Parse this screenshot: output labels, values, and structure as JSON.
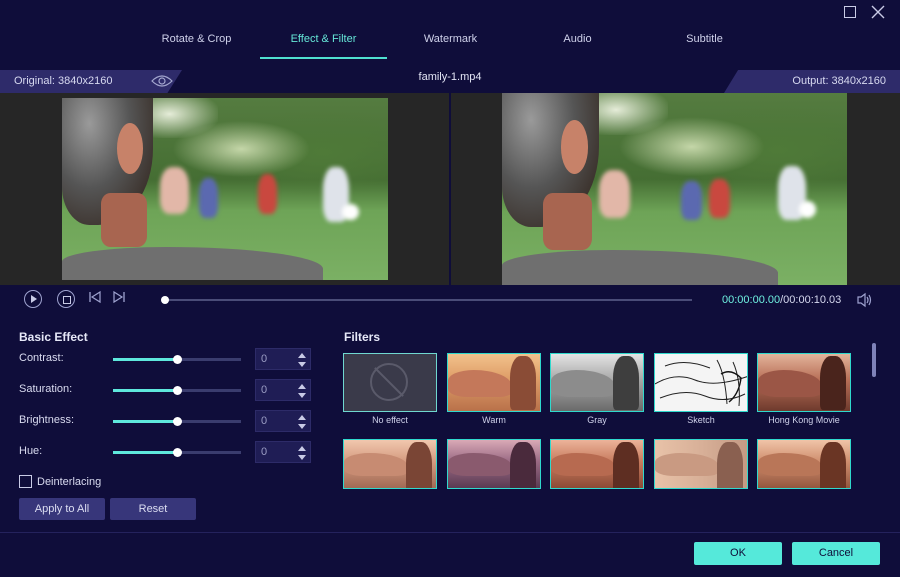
{
  "tabs": [
    {
      "label": "Rotate & Crop"
    },
    {
      "label": "Effect & Filter"
    },
    {
      "label": "Watermark"
    },
    {
      "label": "Audio"
    },
    {
      "label": "Subtitle"
    }
  ],
  "active_tab": "Effect & Filter",
  "info": {
    "original": "Original: 3840x2160",
    "file_name": "family-1.mp4",
    "output": "Output: 3840x2160"
  },
  "player": {
    "current_time": "00:00:00.00",
    "total_time": "/00:00:10.03",
    "progress": 0
  },
  "basic_effect": {
    "title": "Basic Effect",
    "rows": [
      {
        "label": "Contrast:",
        "value": "0",
        "level": 0.5
      },
      {
        "label": "Saturation:",
        "value": "0",
        "level": 0.5
      },
      {
        "label": "Brightness:",
        "value": "0",
        "level": 0.5
      },
      {
        "label": "Hue:",
        "value": "0",
        "level": 0.5
      }
    ],
    "deinterlacing_label": "Deinterlacing",
    "deinterlacing_checked": false,
    "apply_label": "Apply to All",
    "reset_label": "Reset"
  },
  "filters": {
    "title": "Filters",
    "items": [
      {
        "label": "No effect"
      },
      {
        "label": "Warm"
      },
      {
        "label": "Gray"
      },
      {
        "label": "Sketch"
      },
      {
        "label": "Hong Kong Movie"
      },
      {
        "label": ""
      },
      {
        "label": ""
      },
      {
        "label": ""
      },
      {
        "label": ""
      },
      {
        "label": ""
      }
    ]
  },
  "footer": {
    "ok_label": "OK",
    "cancel_label": "Cancel"
  },
  "colors": {
    "background": "#0f0d3a",
    "accent": "#55e9da"
  }
}
